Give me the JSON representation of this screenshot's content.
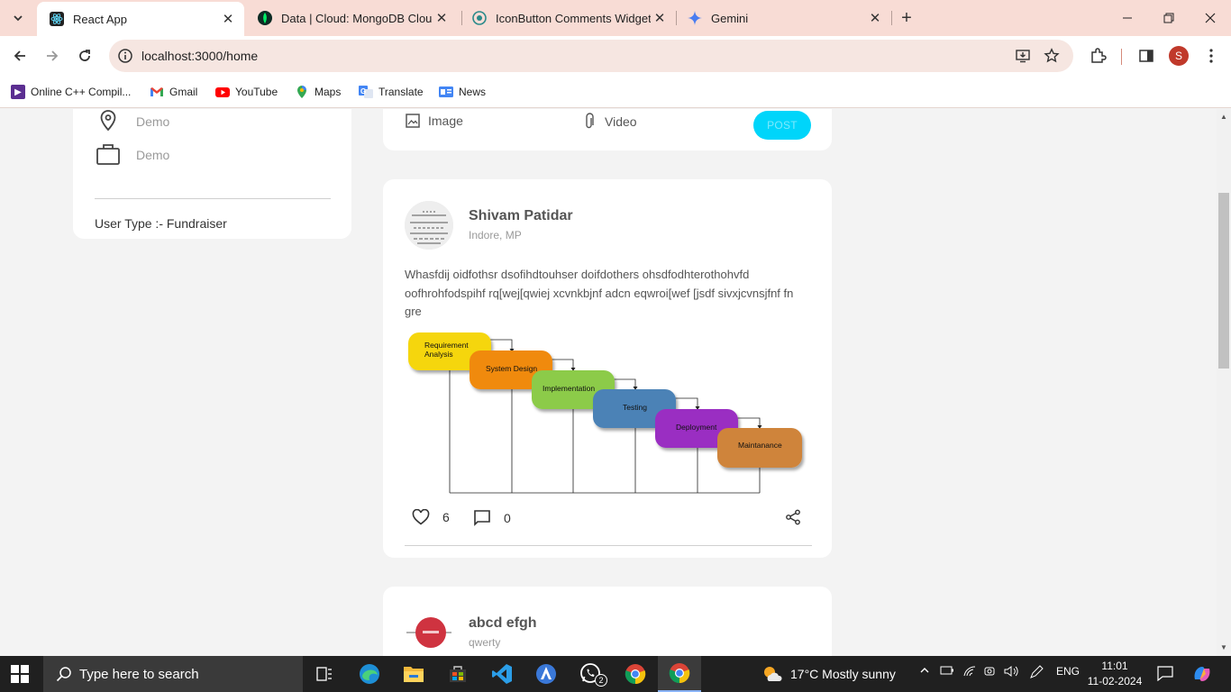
{
  "browser": {
    "tabs": [
      {
        "title": "React App",
        "favicon": "react-icon",
        "active": true
      },
      {
        "title": "Data | Cloud: MongoDB Cloud",
        "favicon": "mongodb-leaf-icon"
      },
      {
        "title": "IconButton Comments Widget",
        "favicon": "iconbutton-icon"
      },
      {
        "title": "Gemini",
        "favicon": "gemini-sparkle-icon"
      }
    ],
    "url": "localhost:3000/home",
    "profile_initial": "S",
    "bookmarks": [
      {
        "label": "Online C++ Compil...",
        "icon": "cpp-icon"
      },
      {
        "label": "Gmail",
        "icon": "gmail-icon"
      },
      {
        "label": "YouTube",
        "icon": "youtube-icon"
      },
      {
        "label": "Maps",
        "icon": "maps-icon"
      },
      {
        "label": "Translate",
        "icon": "translate-icon"
      },
      {
        "label": "News",
        "icon": "news-icon"
      }
    ]
  },
  "profile_card": {
    "location": "Demo",
    "work": "Demo",
    "user_type": "User Type :- Fundraiser"
  },
  "share_box": {
    "image_label": "Image",
    "video_label": "Video",
    "post_label": "POST"
  },
  "posts": [
    {
      "author": "Shivam Patidar",
      "location": "Indore, MP",
      "text": "Whasfdij oidfothsr dsofihdtouhser doifdothers ohsdfodhterothohvfd oofhrohfodspihf rq[wej[qwiej xcvnkbjnf adcn eqwroi[wef [jsdf sivxjcvnsjfnf fn gre",
      "likes": "6",
      "comments": "0",
      "image_stages": [
        "Requirement",
        "Analysis",
        "System Design",
        "Implementation",
        "Testing",
        "Deployment",
        "Maintanance"
      ]
    },
    {
      "author": "abcd efgh",
      "location": "qwerty"
    }
  ],
  "taskbar": {
    "search_placeholder": "Type here to search",
    "weather": "17°C  Mostly sunny",
    "language": "ENG",
    "time": "11:01",
    "date": "11-02-2024",
    "whatsapp_badge": "2"
  },
  "colors": {
    "tab_strip": "#f8dcd5",
    "post_button": "#00d5fa",
    "stage_colors": [
      "#f5d60c",
      "#f08a10",
      "#8ccb4a",
      "#4c82b6",
      "#9a2fc2",
      "#cf843a"
    ]
  }
}
